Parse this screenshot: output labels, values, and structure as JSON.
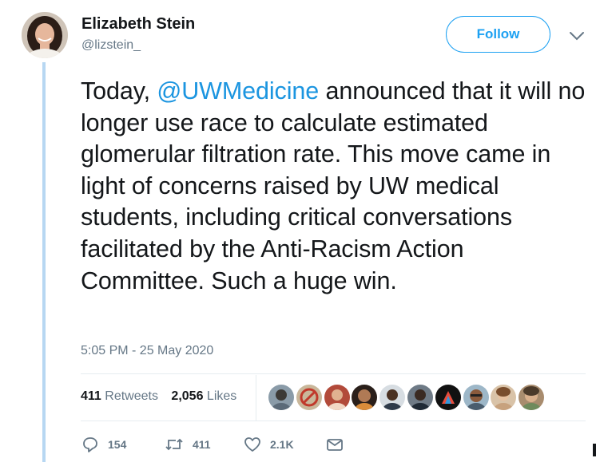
{
  "author": {
    "display_name": "Elizabeth Stein",
    "handle": "@lizstein_"
  },
  "follow_label": "Follow",
  "tweet": {
    "text_before": "Today, ",
    "mention": "@UWMedicine",
    "text_after": " announced that it will no longer use race to calculate estimated glomerular filtration rate. This move came in light of concerns raised by UW medical students, including critical conversations facilitated by the Anti-Racism Action Committee. Such a huge win.",
    "timestamp": "5:05 PM - 25 May 2020"
  },
  "stats": {
    "retweets_count": "411",
    "retweets_label": "Retweets",
    "likes_count": "2,056",
    "likes_label": "Likes"
  },
  "actions": {
    "reply_count": "154",
    "retweet_count": "411",
    "like_count": "2.1K"
  },
  "icons": {
    "reply": "reply-icon",
    "retweet": "retweet-icon",
    "like": "heart-icon",
    "message": "envelope-icon",
    "caret": "chevron-down-icon"
  },
  "colors": {
    "accent": "#1da1f2",
    "mention": "#1b95e0",
    "muted": "#657786",
    "text": "#14171a",
    "thread_line": "#b7d7f2"
  }
}
